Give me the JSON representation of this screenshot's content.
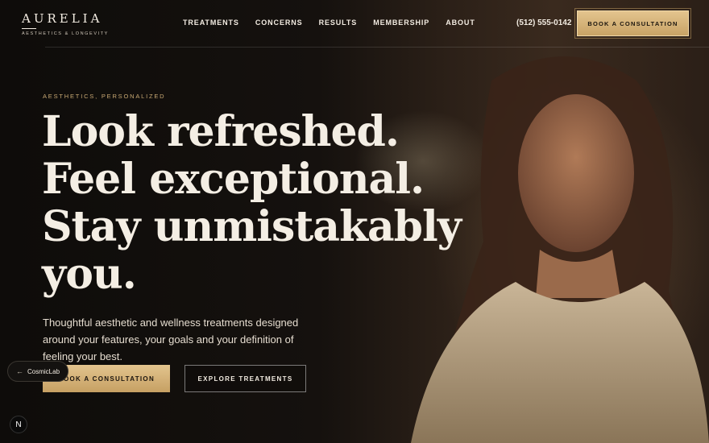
{
  "brand": {
    "name": "AURELIA",
    "tagline": "AESTHETICS & LONGEVITY"
  },
  "nav": {
    "items": [
      {
        "label": "TREATMENTS"
      },
      {
        "label": "CONCERNS"
      },
      {
        "label": "RESULTS"
      },
      {
        "label": "MEMBERSHIP"
      },
      {
        "label": "ABOUT"
      }
    ]
  },
  "header": {
    "phone": "(512) 555-0142",
    "cta": "BOOK A CONSULTATION"
  },
  "hero": {
    "eyebrow": "AESTHETICS, PERSONALIZED",
    "headline_lines": [
      "Look refreshed.",
      "Feel exceptional.",
      "Stay unmistakably",
      "you."
    ],
    "lede": "Thoughtful aesthetic and wellness treatments designed around your features, your goals and your definition of feeling your best.",
    "primary_cta": "BOOK A CONSULTATION",
    "secondary_cta": "EXPLORE TREATMENTS"
  },
  "overlay": {
    "badge_label": "CosmicLab",
    "badge_arrow": "←",
    "n_button": "N"
  },
  "colors": {
    "accent_gold": "#d9b77e",
    "background": "#0f0d0b",
    "text": "#f3ece2"
  },
  "icons": {
    "badge_arrow": "arrow-left-icon",
    "n_button": "next-logo-icon"
  }
}
